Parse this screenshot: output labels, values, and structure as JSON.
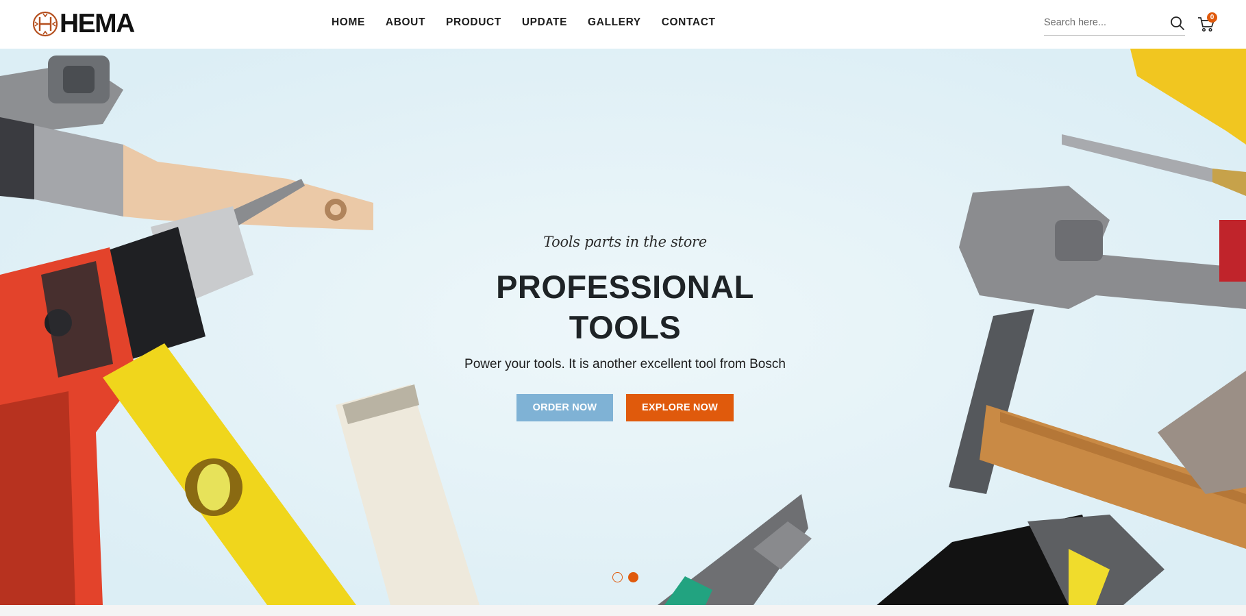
{
  "brand": {
    "name": "HEMA",
    "accent_color": "#e05a0c"
  },
  "nav": {
    "items": [
      {
        "label": "HOME"
      },
      {
        "label": "ABOUT"
      },
      {
        "label": "PRODUCT"
      },
      {
        "label": "UPDATE"
      },
      {
        "label": "GALLERY"
      },
      {
        "label": "CONTACT"
      }
    ]
  },
  "search": {
    "placeholder": "Search here...",
    "icon": "search-icon"
  },
  "cart": {
    "icon": "cart-icon",
    "count": "0"
  },
  "hero": {
    "tagline": "Tools parts in the store",
    "headline_line1": "PROFESSIONAL",
    "headline_line2": "TOOLS",
    "subtext": "Power your tools. It is another excellent tool from Bosch",
    "order_button": "ORDER NOW",
    "explore_button": "EXPLORE NOW",
    "order_button_color": "#7fb2d5",
    "explore_button_color": "#e05a0c",
    "slides": {
      "count": 2,
      "active_index": 1
    },
    "background_colors": [
      "#e6f3f8"
    ]
  }
}
